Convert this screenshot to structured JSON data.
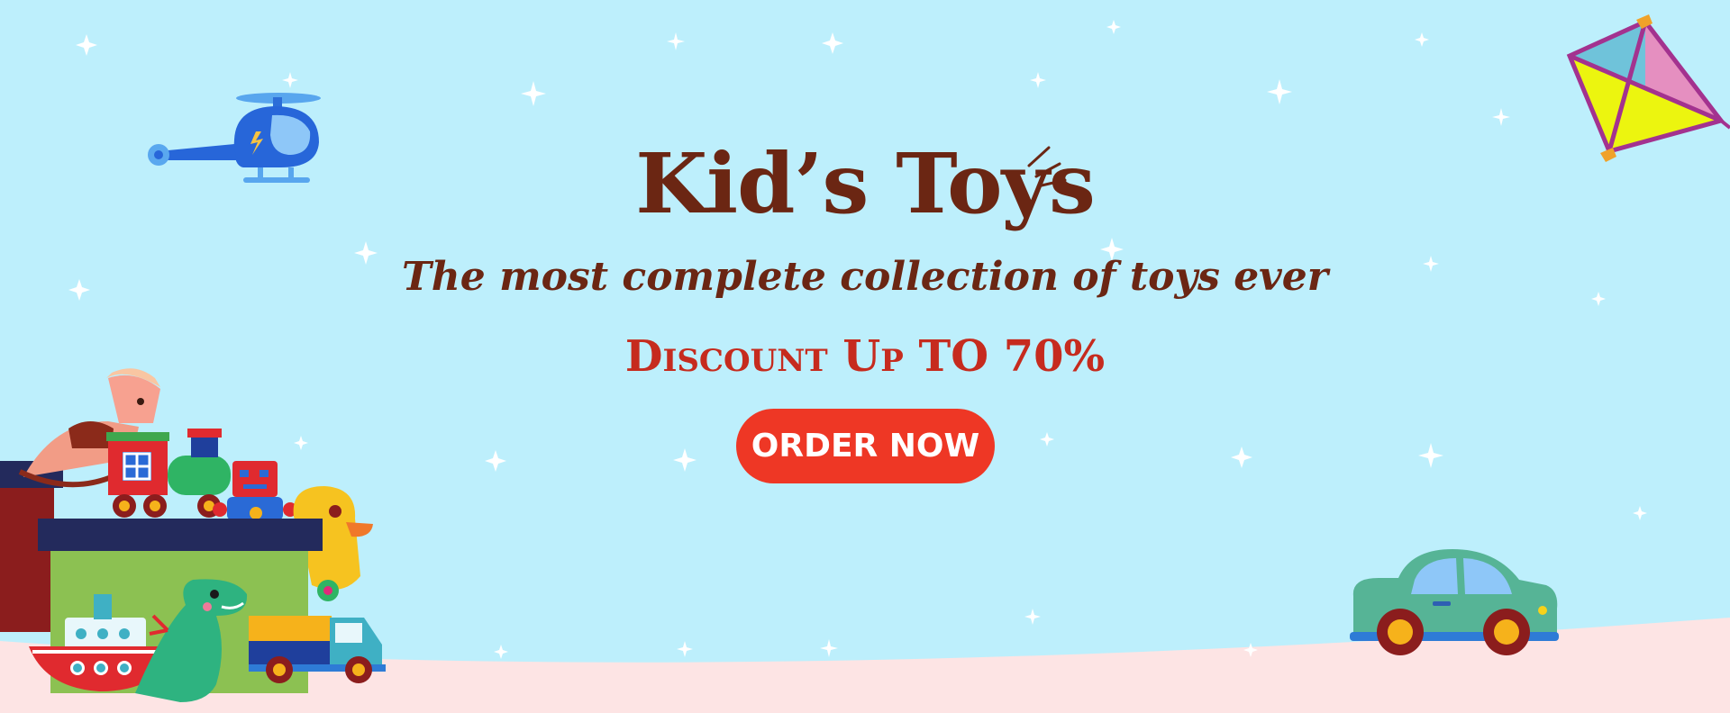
{
  "banner": {
    "title": "Kid’s Toys",
    "tagline": "The most complete collection of toys ever",
    "discount": "Discount Up TO 70%",
    "order_button": "ORDER NOW"
  },
  "colors": {
    "sky": "#bdeffc",
    "ground": "#fde4e4",
    "title": "#6b2613",
    "discount": "#c62b1e",
    "button": "#ee3725",
    "button_text": "#ffffff"
  },
  "icons": {
    "helicopter": "helicopter-icon",
    "kite": "kite-icon",
    "car": "toy-car-icon",
    "toy_box": "toy-box-icon",
    "sparkle": "sparkle-icon"
  }
}
